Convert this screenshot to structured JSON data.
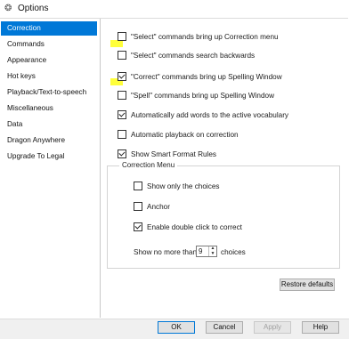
{
  "window": {
    "title": "Options",
    "app_icon": "dragon-app-icon"
  },
  "sidebar": {
    "items": [
      {
        "label": "Correction",
        "selected": true
      },
      {
        "label": "Commands"
      },
      {
        "label": "Appearance"
      },
      {
        "label": "Hot keys"
      },
      {
        "label": "Playback/Text-to-speech"
      },
      {
        "label": "Miscellaneous"
      },
      {
        "label": "Data"
      },
      {
        "label": "Dragon Anywhere"
      },
      {
        "label": "Upgrade To Legal"
      }
    ]
  },
  "correction": {
    "options": [
      {
        "label": "\"Select\" commands bring up Correction menu",
        "checked": false
      },
      {
        "label": "\"Select\" commands search backwards",
        "checked": false
      },
      {
        "label": "\"Correct\" commands bring up Spelling Window",
        "checked": true
      },
      {
        "label": "\"Spell\" commands bring up Spelling Window",
        "checked": false
      },
      {
        "label": "Automatically add words to the active vocabulary",
        "checked": true
      },
      {
        "label": "Automatic playback on correction",
        "checked": false
      },
      {
        "label": "Show Smart Format Rules",
        "checked": true
      }
    ],
    "menu_group": {
      "title": "Correction Menu",
      "options": [
        {
          "label": "Show only the choices",
          "checked": false
        },
        {
          "label": "Anchor",
          "checked": false
        },
        {
          "label": "Enable double click to correct",
          "checked": true
        }
      ],
      "show_no_more_than_label": "Show no more than",
      "choices_count": "9",
      "choices_label": "choices"
    },
    "restore_defaults_label": "Restore defaults"
  },
  "highlight_color": "#ffff3a",
  "accent_color": "#0078d7",
  "footer": {
    "ok": "OK",
    "cancel": "Cancel",
    "apply": "Apply",
    "help": "Help"
  }
}
